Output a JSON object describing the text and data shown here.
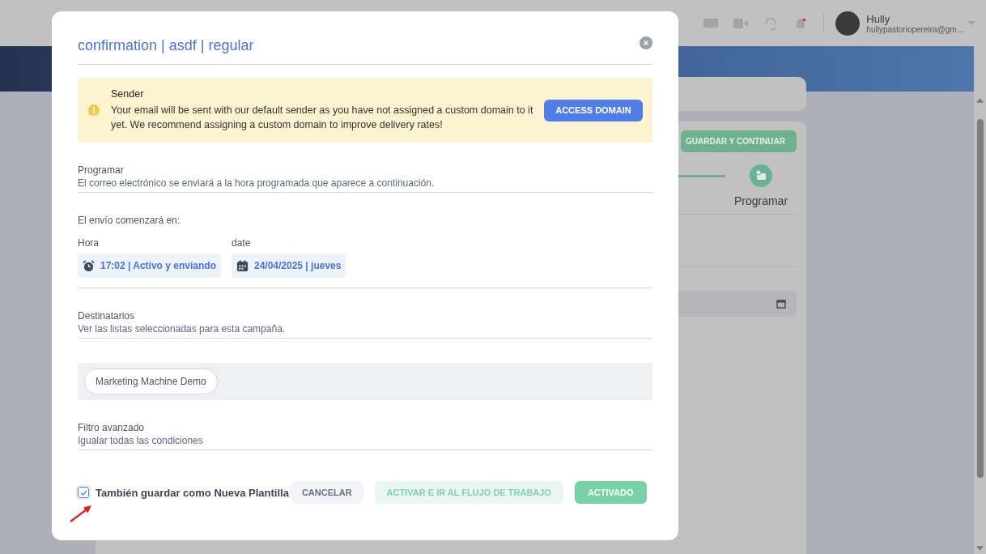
{
  "topbar": {
    "user": {
      "name": "Hully",
      "email": "hullypastoriopereira@gm..."
    }
  },
  "background": {
    "primary_button": "GUARDAR Y CONTINUAR",
    "step_label": "Programar"
  },
  "modal": {
    "title": "confirmation | asdf | regular",
    "alert": {
      "title": "Sender",
      "message": "Your email will be sent with our default sender as you have not assigned a custom domain to it yet. We recommend assigning a custom domain to improve delivery rates!",
      "button": "ACCESS DOMAIN"
    },
    "schedule": {
      "title": "Programar",
      "description": "El correo electrónico se enviará a la hora programada que aparece a continuación."
    },
    "start": {
      "label": "El envío comenzará en:",
      "fields": [
        {
          "label": "Hora",
          "value": "17:02 | Activo y enviando",
          "kind": "time"
        },
        {
          "label": "date",
          "value": "24/04/2025 | jueves",
          "kind": "date"
        }
      ]
    },
    "recipients": {
      "title": "Destinatarios",
      "description": "Ver las listas seleccionadas para esta campaña.",
      "lists": [
        "Marketing Machine Demo"
      ]
    },
    "filter": {
      "title": "Filtro avanzado",
      "description": "Igualar todas las condiciones"
    },
    "save_template": {
      "label": "También guardar como Nueva Plantilla",
      "checked": true
    },
    "buttons": [
      {
        "label": "CANCELAR",
        "kind": "neutral"
      },
      {
        "label": "ACTIVAR E IR AL FLUJO DE TRABAJO",
        "kind": "light"
      },
      {
        "label": "ACTIVADO",
        "kind": "primary"
      }
    ]
  }
}
